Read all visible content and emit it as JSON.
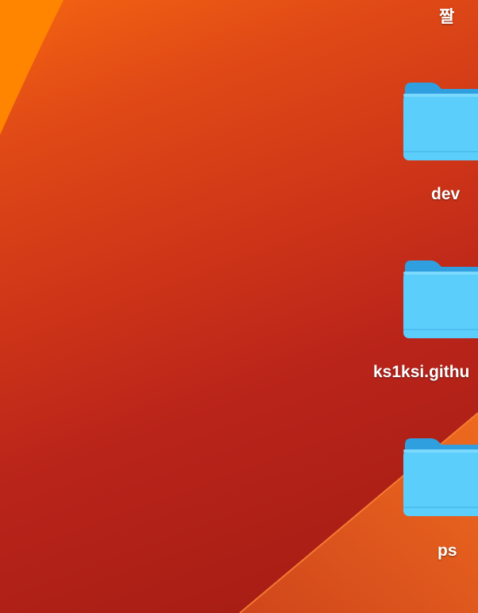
{
  "desktop": {
    "wallpaper_colors": [
      "#f36312",
      "#cd3418",
      "#a11b12",
      "#e8591a"
    ],
    "items": [
      {
        "label": "짤",
        "icon": "folder-icon"
      },
      {
        "label": "dev",
        "icon": "folder-icon"
      },
      {
        "label": "ks1ksi.githu",
        "icon": "folder-icon"
      },
      {
        "label": "ps",
        "icon": "folder-icon"
      }
    ],
    "folder_color": "#5ccefc"
  }
}
